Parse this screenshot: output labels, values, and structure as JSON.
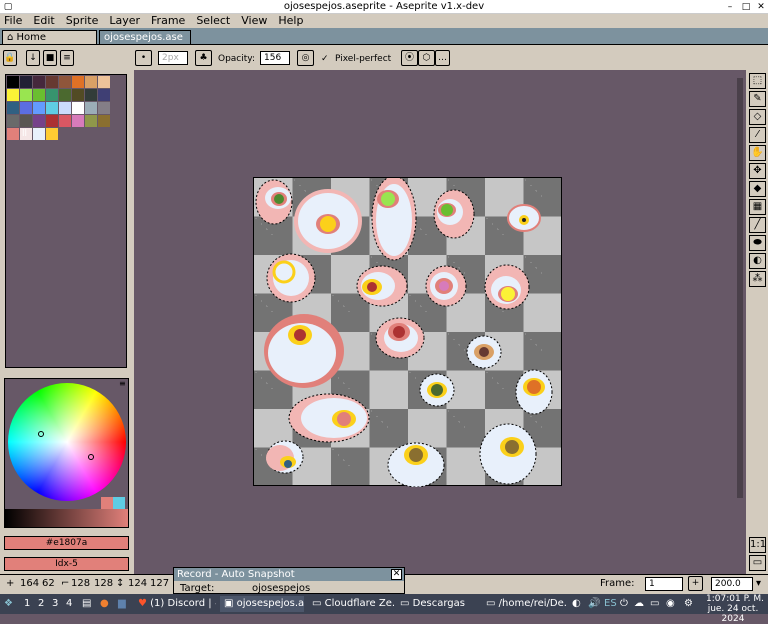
{
  "window": {
    "title": "ojosespejos.aseprite - Aseprite v1.x-dev"
  },
  "menu": [
    "File",
    "Edit",
    "Sprite",
    "Layer",
    "Frame",
    "Select",
    "View",
    "Help"
  ],
  "tabs": {
    "home": "Home",
    "file": "ojosespejos.ase"
  },
  "context": {
    "brush_size": "2px",
    "opacity_label": "Opacity:",
    "opacity_value": "156",
    "pixel_perfect": "Pixel-perfect"
  },
  "palette": [
    "#000000",
    "#222034",
    "#45283c",
    "#663931",
    "#8f563b",
    "#df7126",
    "#d9a066",
    "#eec39a",
    "#fbf236",
    "#99e550",
    "#6abe30",
    "#37946e",
    "#4b692f",
    "#524b24",
    "#323c39",
    "#3f3f74",
    "#306082",
    "#5b6ee1",
    "#639bff",
    "#5fcde4",
    "#cbdbfc",
    "#ffffff",
    "#9badb7",
    "#847e87",
    "#696a6a",
    "#595652",
    "#76428a",
    "#ac3232",
    "#d95763",
    "#d77bba",
    "#8f974a",
    "#8a6f30",
    "#e1807a",
    "#f5e6e6",
    "#e8f0fb",
    "#ffcc33"
  ],
  "colors": {
    "fg": "#e1807a",
    "bg": "#675867"
  },
  "color_hex": "#e1807a",
  "color_idx": "Idx-5",
  "status": {
    "x": "164",
    "y": "62",
    "w": "128",
    "h": "128",
    "bx": "124",
    "by": "127",
    "frame_label": "Frame:",
    "frame": "1",
    "zoom": "200.0"
  },
  "record": {
    "title": "Record - Auto Snapshot",
    "target_label": "Target:",
    "target_value": "ojosespejos"
  },
  "taskbar": {
    "workspaces": [
      "1",
      "2",
      "3",
      "4"
    ],
    "windows": [
      "(1) Discord | #...",
      "ojosespejos.a...",
      "Cloudflare Ze...",
      "Descargas",
      "/home/rei/De..."
    ],
    "lang": "ES",
    "time": "1:07:01 P. M.",
    "date": "jue. 24 oct. 2024"
  }
}
